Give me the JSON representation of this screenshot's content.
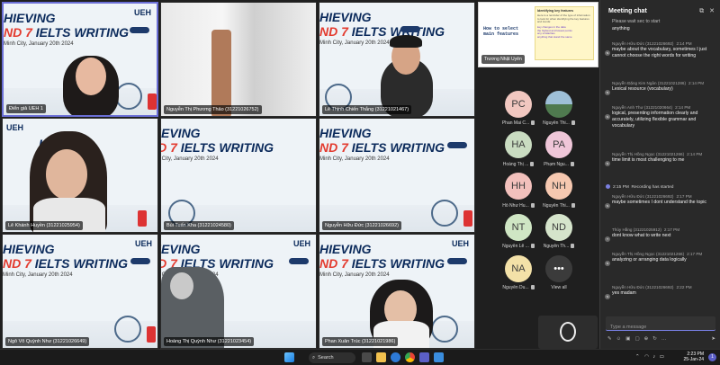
{
  "banner": {
    "line1": "HIEVING",
    "line2_red": "ND 7",
    "line2_rest": " IELTS WRITING",
    "subtitle": "Minh City, January 20th 2024",
    "school": "UEH"
  },
  "tiles": [
    {
      "name": "Điển giả UEH 1"
    },
    {
      "name": "Nguyễn Thị Phương Thảo (31221026752)"
    },
    {
      "name": "Lê Thịnh Chiến Thắng (31221021467)"
    },
    {
      "name": "Lê Khánh Huyền (31221025954)"
    },
    {
      "name": "Bùi Tuấn Kha (31221024580)"
    },
    {
      "name": "Nguyễn Hữu Đức (31221026692)"
    },
    {
      "name": "Ngô Võ Quỳnh Như (31221026649)"
    },
    {
      "name": "Hoàng Thị Quỳnh Như (31221023454)"
    },
    {
      "name": "Phan Xuân Trúc (31221021986)"
    }
  ],
  "slide": {
    "title": "How to select main features",
    "note_heading": "Identifying key features",
    "note_text": "Here is a reminder of the type of information to look for when identifying the key features and trends:",
    "bullets": [
      "key changes in the data",
      "the highest and lowest points",
      "any similarities",
      "anything that stand the same"
    ],
    "presenter": "Trương Nhật Uyên"
  },
  "participants": [
    {
      "initials": "PC",
      "label": "Phan Mai C...",
      "color": "#f1c7c0"
    },
    {
      "initials": "",
      "label": "Nguyễn Thi...",
      "color": "#8aa6c0"
    },
    {
      "initials": "HA",
      "label": "Hoàng Thị ...",
      "color": "#c9dcc1"
    },
    {
      "initials": "PA",
      "label": "Phạm Ngu...",
      "color": "#efc6d8"
    },
    {
      "initials": "HH",
      "label": "Hồ Như Hu...",
      "color": "#f2c0bc"
    },
    {
      "initials": "NH",
      "label": "Nguyễn Thi...",
      "color": "#f6c8b0"
    },
    {
      "initials": "NT",
      "label": "Nguyễn Lê ...",
      "color": "#cfe6c4"
    },
    {
      "initials": "ND",
      "label": "Nguyễn Th...",
      "color": "#d5e4cb"
    },
    {
      "initials": "NA",
      "label": "Nguyễn Du...",
      "color": "#f3e1a8"
    },
    {
      "initials": "•••",
      "label": "View all",
      "color": "#3b3b3b"
    }
  ],
  "chat": {
    "title": "Meeting chat",
    "top_fragment_1": "Please wait sec to start",
    "top_fragment_2": "anything",
    "messages": [
      {
        "sender": "Nguyễn Hữu Đức (31221026692)",
        "time": "2:14 PM",
        "text": "maybe about the vocabulary, sometimes I just cannot choose the right words for writing"
      },
      {
        "sender": "Nguyễn Đặng Kim Ngân (31221021286)",
        "time": "2:14 PM",
        "text": "Lexical resource (vocabulary)"
      },
      {
        "sender": "Nguyễn Anh Thư (31221020664)",
        "time": "2:14 PM",
        "text": "logical, presenting information clearly and accurately, utilizing flexible grammar and vocabulary"
      },
      {
        "sender": "Nguyễn Thị Hồng Ngọc (31221021266)",
        "time": "2:14 PM",
        "text": "time limit is most challenging to me"
      },
      {
        "sender": "Nguyễn Hữu Đức (31221026692)",
        "time": "2:17 PM",
        "text": "maybe sometimes I dont understand the topic"
      },
      {
        "sender": "Thủy Hằng (31221025912)",
        "time": "2:17 PM",
        "text": "dont know what to write next"
      },
      {
        "sender": "Nguyễn Thị Hồng Ngọc (31221021266)",
        "time": "2:17 PM",
        "text": "analyzing or arranging data logically"
      },
      {
        "sender": "Nguyễn Hữu Đức (31221026692)",
        "time": "2:22 PM",
        "text": "yes madam"
      }
    ],
    "system_time": "2:15 PM",
    "system_text": "Recording has started",
    "compose_placeholder": "Type a message"
  },
  "taskbar": {
    "search_label": "Search",
    "time": "2:23 PM",
    "date": "25-Jan-24"
  }
}
